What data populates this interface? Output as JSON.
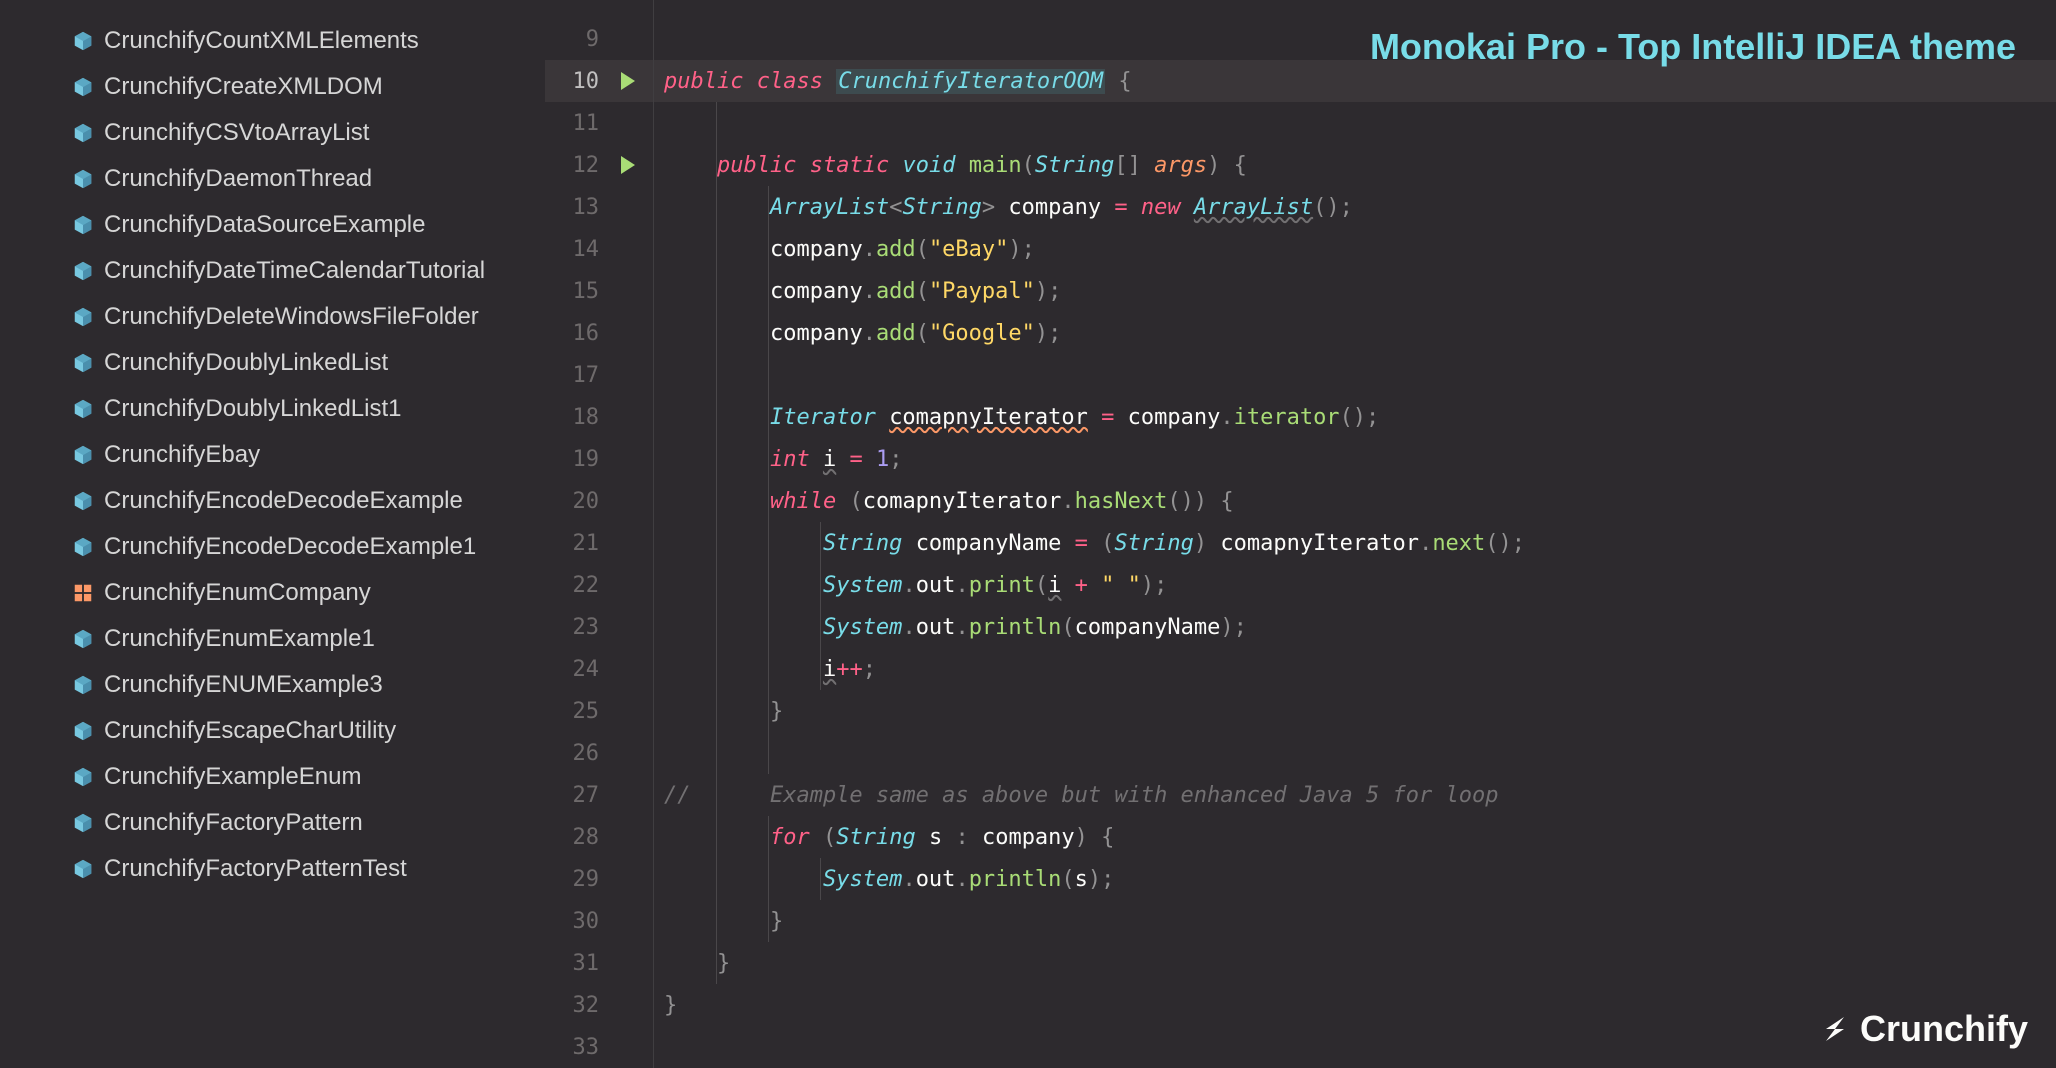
{
  "banner": "Monokai Pro - Top IntelliJ IDEA theme",
  "logo": "Crunchify",
  "sidebar": {
    "files": [
      {
        "name": "CrunchifyCountXMLElements",
        "icon": "cube"
      },
      {
        "name": "CrunchifyCreateXMLDOM",
        "icon": "cube"
      },
      {
        "name": "CrunchifyCSVtoArrayList",
        "icon": "cube"
      },
      {
        "name": "CrunchifyDaemonThread",
        "icon": "cube"
      },
      {
        "name": "CrunchifyDataSourceExample",
        "icon": "cube"
      },
      {
        "name": "CrunchifyDateTimeCalendarTutorial",
        "icon": "cube"
      },
      {
        "name": "CrunchifyDeleteWindowsFileFolder",
        "icon": "cube"
      },
      {
        "name": "CrunchifyDoublyLinkedList",
        "icon": "cube"
      },
      {
        "name": "CrunchifyDoublyLinkedList1",
        "icon": "cube"
      },
      {
        "name": "CrunchifyEbay",
        "icon": "cube"
      },
      {
        "name": "CrunchifyEncodeDecodeExample",
        "icon": "cube"
      },
      {
        "name": "CrunchifyEncodeDecodeExample1",
        "icon": "cube"
      },
      {
        "name": "CrunchifyEnumCompany",
        "icon": "grid"
      },
      {
        "name": "CrunchifyEnumExample1",
        "icon": "cube"
      },
      {
        "name": "CrunchifyENUMExample3",
        "icon": "cube"
      },
      {
        "name": "CrunchifyEscapeCharUtility",
        "icon": "cube"
      },
      {
        "name": "CrunchifyExampleEnum",
        "icon": "cube"
      },
      {
        "name": "CrunchifyFactoryPattern",
        "icon": "cube"
      },
      {
        "name": "CrunchifyFactoryPatternTest",
        "icon": "cube"
      }
    ]
  },
  "editor": {
    "lines": [
      {
        "num": 9,
        "active": false,
        "run": false,
        "indent": [],
        "code": []
      },
      {
        "num": 10,
        "active": true,
        "run": true,
        "indent": [],
        "code": [
          {
            "t": "kw",
            "v": "public"
          },
          {
            "t": "sp",
            "v": " "
          },
          {
            "t": "kw",
            "v": "class"
          },
          {
            "t": "sp",
            "v": " "
          },
          {
            "t": "clsname hl",
            "v": "CrunchifyIteratorOOM"
          },
          {
            "t": "sp",
            "v": " "
          },
          {
            "t": "punct",
            "v": "{"
          }
        ]
      },
      {
        "num": 11,
        "active": false,
        "run": false,
        "indent": [
          1
        ],
        "code": []
      },
      {
        "num": 12,
        "active": false,
        "run": true,
        "fold": true,
        "indent": [
          1
        ],
        "code": [
          {
            "t": "sp",
            "v": "    "
          },
          {
            "t": "kw",
            "v": "public"
          },
          {
            "t": "sp",
            "v": " "
          },
          {
            "t": "kw",
            "v": "static"
          },
          {
            "t": "sp",
            "v": " "
          },
          {
            "t": "type",
            "v": "void"
          },
          {
            "t": "sp",
            "v": " "
          },
          {
            "t": "method",
            "v": "main"
          },
          {
            "t": "punct",
            "v": "("
          },
          {
            "t": "type",
            "v": "String"
          },
          {
            "t": "punct",
            "v": "[] "
          },
          {
            "t": "param",
            "v": "args"
          },
          {
            "t": "punct",
            "v": ")"
          },
          {
            "t": "sp",
            "v": " "
          },
          {
            "t": "punct",
            "v": "{"
          }
        ]
      },
      {
        "num": 13,
        "active": false,
        "run": false,
        "indent": [
          1,
          2
        ],
        "code": [
          {
            "t": "sp",
            "v": "        "
          },
          {
            "t": "type",
            "v": "ArrayList"
          },
          {
            "t": "punct",
            "v": "<"
          },
          {
            "t": "type",
            "v": "String"
          },
          {
            "t": "punct",
            "v": ">"
          },
          {
            "t": "sp",
            "v": " "
          },
          {
            "t": "id",
            "v": "company"
          },
          {
            "t": "sp",
            "v": " "
          },
          {
            "t": "op",
            "v": "="
          },
          {
            "t": "sp",
            "v": " "
          },
          {
            "t": "kw",
            "v": "new"
          },
          {
            "t": "sp",
            "v": " "
          },
          {
            "t": "type wavy",
            "v": "ArrayList"
          },
          {
            "t": "punct",
            "v": "();"
          }
        ]
      },
      {
        "num": 14,
        "active": false,
        "run": false,
        "indent": [
          1,
          2
        ],
        "code": [
          {
            "t": "sp",
            "v": "        "
          },
          {
            "t": "id",
            "v": "company"
          },
          {
            "t": "punct",
            "v": "."
          },
          {
            "t": "method",
            "v": "add"
          },
          {
            "t": "punct",
            "v": "("
          },
          {
            "t": "str",
            "v": "\"eBay\""
          },
          {
            "t": "punct",
            "v": ");"
          }
        ]
      },
      {
        "num": 15,
        "active": false,
        "run": false,
        "indent": [
          1,
          2
        ],
        "code": [
          {
            "t": "sp",
            "v": "        "
          },
          {
            "t": "id",
            "v": "company"
          },
          {
            "t": "punct",
            "v": "."
          },
          {
            "t": "method",
            "v": "add"
          },
          {
            "t": "punct",
            "v": "("
          },
          {
            "t": "str",
            "v": "\"Paypal\""
          },
          {
            "t": "punct",
            "v": ");"
          }
        ]
      },
      {
        "num": 16,
        "active": false,
        "run": false,
        "indent": [
          1,
          2
        ],
        "code": [
          {
            "t": "sp",
            "v": "        "
          },
          {
            "t": "id",
            "v": "company"
          },
          {
            "t": "punct",
            "v": "."
          },
          {
            "t": "method",
            "v": "add"
          },
          {
            "t": "punct",
            "v": "("
          },
          {
            "t": "str",
            "v": "\"Google\""
          },
          {
            "t": "punct",
            "v": ");"
          }
        ]
      },
      {
        "num": 17,
        "active": false,
        "run": false,
        "indent": [
          1,
          2
        ],
        "code": []
      },
      {
        "num": 18,
        "active": false,
        "run": false,
        "indent": [
          1,
          2
        ],
        "code": [
          {
            "t": "sp",
            "v": "        "
          },
          {
            "t": "type",
            "v": "Iterator"
          },
          {
            "t": "sp",
            "v": " "
          },
          {
            "t": "id wavyo",
            "v": "comapnyIterator"
          },
          {
            "t": "sp",
            "v": " "
          },
          {
            "t": "op",
            "v": "="
          },
          {
            "t": "sp",
            "v": " "
          },
          {
            "t": "id",
            "v": "company"
          },
          {
            "t": "punct",
            "v": "."
          },
          {
            "t": "method",
            "v": "iterator"
          },
          {
            "t": "punct",
            "v": "();"
          }
        ]
      },
      {
        "num": 19,
        "active": false,
        "run": false,
        "indent": [
          1,
          2
        ],
        "code": [
          {
            "t": "sp",
            "v": "        "
          },
          {
            "t": "kw",
            "v": "int"
          },
          {
            "t": "sp",
            "v": " "
          },
          {
            "t": "id wavy",
            "v": "i"
          },
          {
            "t": "sp",
            "v": " "
          },
          {
            "t": "op",
            "v": "="
          },
          {
            "t": "sp",
            "v": " "
          },
          {
            "t": "num",
            "v": "1"
          },
          {
            "t": "punct",
            "v": ";"
          }
        ]
      },
      {
        "num": 20,
        "active": false,
        "run": false,
        "fold": true,
        "indent": [
          1,
          2
        ],
        "code": [
          {
            "t": "sp",
            "v": "        "
          },
          {
            "t": "kw",
            "v": "while"
          },
          {
            "t": "sp",
            "v": " "
          },
          {
            "t": "punct",
            "v": "("
          },
          {
            "t": "id",
            "v": "comapnyIterator"
          },
          {
            "t": "punct",
            "v": "."
          },
          {
            "t": "method",
            "v": "hasNext"
          },
          {
            "t": "punct",
            "v": "())"
          },
          {
            "t": "sp",
            "v": " "
          },
          {
            "t": "punct",
            "v": "{"
          }
        ]
      },
      {
        "num": 21,
        "active": false,
        "run": false,
        "indent": [
          1,
          2,
          3
        ],
        "code": [
          {
            "t": "sp",
            "v": "            "
          },
          {
            "t": "type",
            "v": "String"
          },
          {
            "t": "sp",
            "v": " "
          },
          {
            "t": "id",
            "v": "companyName"
          },
          {
            "t": "sp",
            "v": " "
          },
          {
            "t": "op",
            "v": "="
          },
          {
            "t": "sp",
            "v": " "
          },
          {
            "t": "punct",
            "v": "("
          },
          {
            "t": "type",
            "v": "String"
          },
          {
            "t": "punct",
            "v": ")"
          },
          {
            "t": "sp",
            "v": " "
          },
          {
            "t": "id",
            "v": "comapnyIterator"
          },
          {
            "t": "punct",
            "v": "."
          },
          {
            "t": "method",
            "v": "next"
          },
          {
            "t": "punct",
            "v": "();"
          }
        ]
      },
      {
        "num": 22,
        "active": false,
        "run": false,
        "indent": [
          1,
          2,
          3
        ],
        "code": [
          {
            "t": "sp",
            "v": "            "
          },
          {
            "t": "type",
            "v": "System"
          },
          {
            "t": "punct",
            "v": "."
          },
          {
            "t": "id",
            "v": "out"
          },
          {
            "t": "punct",
            "v": "."
          },
          {
            "t": "method",
            "v": "print"
          },
          {
            "t": "punct",
            "v": "("
          },
          {
            "t": "id wavy",
            "v": "i"
          },
          {
            "t": "sp",
            "v": " "
          },
          {
            "t": "op",
            "v": "+"
          },
          {
            "t": "sp",
            "v": " "
          },
          {
            "t": "str",
            "v": "\" \""
          },
          {
            "t": "punct",
            "v": ");"
          }
        ]
      },
      {
        "num": 23,
        "active": false,
        "run": false,
        "indent": [
          1,
          2,
          3
        ],
        "code": [
          {
            "t": "sp",
            "v": "            "
          },
          {
            "t": "type",
            "v": "System"
          },
          {
            "t": "punct",
            "v": "."
          },
          {
            "t": "id",
            "v": "out"
          },
          {
            "t": "punct",
            "v": "."
          },
          {
            "t": "method",
            "v": "println"
          },
          {
            "t": "punct",
            "v": "("
          },
          {
            "t": "id",
            "v": "companyName"
          },
          {
            "t": "punct",
            "v": ");"
          }
        ]
      },
      {
        "num": 24,
        "active": false,
        "run": false,
        "indent": [
          1,
          2,
          3
        ],
        "code": [
          {
            "t": "sp",
            "v": "            "
          },
          {
            "t": "id wavy",
            "v": "i"
          },
          {
            "t": "op",
            "v": "++"
          },
          {
            "t": "punct",
            "v": ";"
          }
        ]
      },
      {
        "num": 25,
        "active": false,
        "run": false,
        "fold": true,
        "indent": [
          1,
          2
        ],
        "code": [
          {
            "t": "sp",
            "v": "        "
          },
          {
            "t": "punct",
            "v": "}"
          }
        ]
      },
      {
        "num": 26,
        "active": false,
        "run": false,
        "indent": [
          1,
          2
        ],
        "code": []
      },
      {
        "num": 27,
        "active": false,
        "run": false,
        "indent": [
          1
        ],
        "code": [
          {
            "t": "comment",
            "v": "//      Example same as above but with enhanced Java 5 for loop"
          }
        ]
      },
      {
        "num": 28,
        "active": false,
        "run": false,
        "fold": true,
        "indent": [
          1,
          2
        ],
        "code": [
          {
            "t": "sp",
            "v": "        "
          },
          {
            "t": "kw",
            "v": "for"
          },
          {
            "t": "sp",
            "v": " "
          },
          {
            "t": "punct",
            "v": "("
          },
          {
            "t": "type",
            "v": "String"
          },
          {
            "t": "sp",
            "v": " "
          },
          {
            "t": "id",
            "v": "s"
          },
          {
            "t": "sp",
            "v": " "
          },
          {
            "t": "punct",
            "v": ":"
          },
          {
            "t": "sp",
            "v": " "
          },
          {
            "t": "id",
            "v": "company"
          },
          {
            "t": "punct",
            "v": ")"
          },
          {
            "t": "sp",
            "v": " "
          },
          {
            "t": "punct",
            "v": "{"
          }
        ]
      },
      {
        "num": 29,
        "active": false,
        "run": false,
        "indent": [
          1,
          2,
          3
        ],
        "code": [
          {
            "t": "sp",
            "v": "            "
          },
          {
            "t": "type",
            "v": "System"
          },
          {
            "t": "punct",
            "v": "."
          },
          {
            "t": "id",
            "v": "out"
          },
          {
            "t": "punct",
            "v": "."
          },
          {
            "t": "method",
            "v": "println"
          },
          {
            "t": "punct",
            "v": "("
          },
          {
            "t": "id",
            "v": "s"
          },
          {
            "t": "punct",
            "v": ");"
          }
        ]
      },
      {
        "num": 30,
        "active": false,
        "run": false,
        "fold": true,
        "indent": [
          1,
          2
        ],
        "code": [
          {
            "t": "sp",
            "v": "        "
          },
          {
            "t": "punct",
            "v": "}"
          }
        ]
      },
      {
        "num": 31,
        "active": false,
        "run": false,
        "fold": true,
        "indent": [
          1
        ],
        "code": [
          {
            "t": "sp",
            "v": "    "
          },
          {
            "t": "punct",
            "v": "}"
          }
        ]
      },
      {
        "num": 32,
        "active": false,
        "run": false,
        "indent": [],
        "code": [
          {
            "t": "punct",
            "v": "}"
          }
        ]
      },
      {
        "num": 33,
        "active": false,
        "run": false,
        "indent": [],
        "code": []
      }
    ]
  }
}
